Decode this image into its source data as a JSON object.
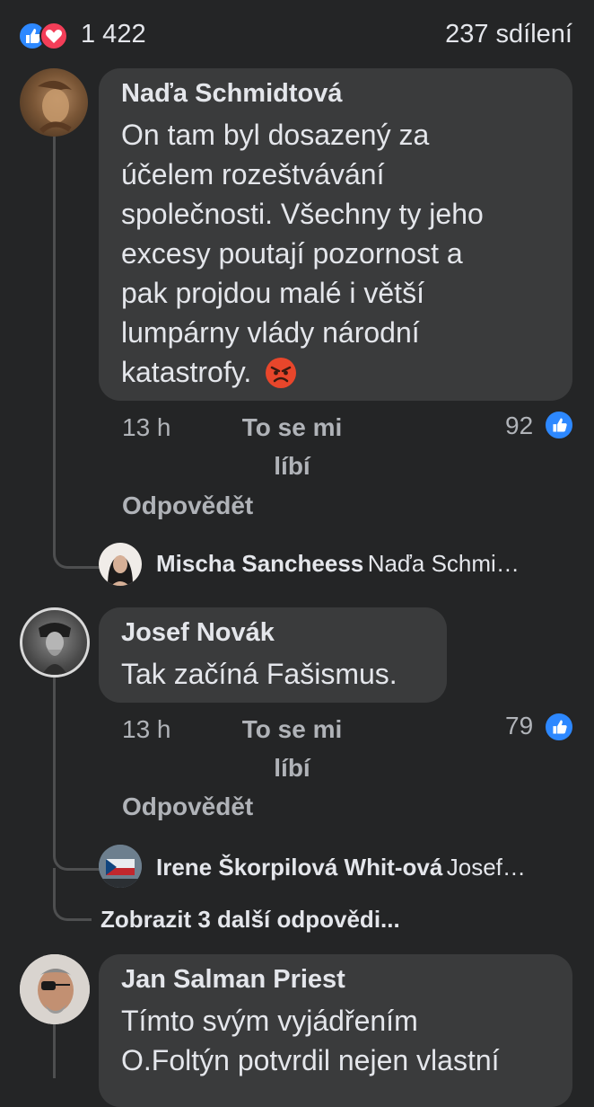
{
  "header": {
    "reaction_count": "1 422",
    "shares": "237 sdílení"
  },
  "comments": [
    {
      "author": "Naďa Schmidtová",
      "text_lines": [
        "On tam byl dosazený za",
        "účelem rozeštvávání",
        "společnosti. Všechny ty jeho",
        "excesy poutají pozornost a",
        "pak projdou malé i větší",
        "lumpárny vlády národní",
        "katastrofy."
      ],
      "emoji": "angry-face-emoji",
      "time": "13 h",
      "like_line1": "To se mi",
      "like_line2": "líbí",
      "reply": "Odpovědět",
      "likes": "92",
      "nested_reply": {
        "author": "Mischa Sancheess",
        "preview": "Naďa Schmi…"
      }
    },
    {
      "author": "Josef Novák",
      "text_lines": [
        "Tak začíná Fašismus."
      ],
      "time": "13 h",
      "like_line1": "To se mi",
      "like_line2": "líbí",
      "reply": "Odpovědět",
      "likes": "79",
      "nested_reply": {
        "author": "Irene Škorpilová Whit-ová",
        "preview": "Josef…"
      },
      "more_replies": "Zobrazit 3 další odpovědi..."
    },
    {
      "author": "Jan Salman Priest",
      "text_lines": [
        "Tímto svým vyjádřením",
        "O.Foltýn potvrdil nejen vlastní"
      ]
    }
  ],
  "colors": {
    "like_blue": "#2d88ff",
    "love_red": "#f33e58",
    "background": "#242526",
    "bubble": "#3a3b3c"
  }
}
